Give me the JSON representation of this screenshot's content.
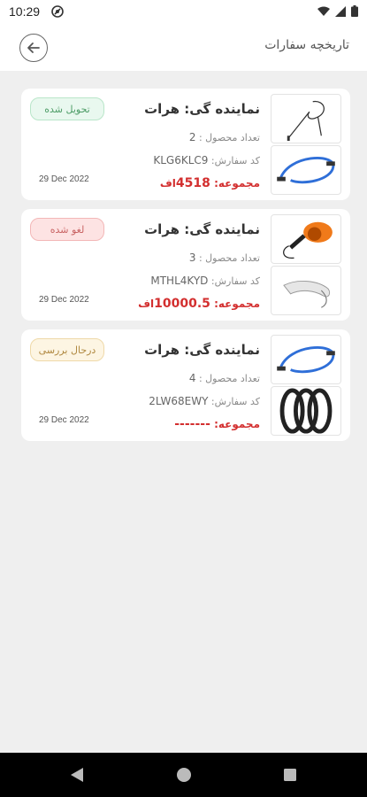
{
  "status_bar": {
    "time": "10:29"
  },
  "header": {
    "title": "تاریخچه سفارات"
  },
  "orders": [
    {
      "dealer": "نماینده گی: هرات",
      "count_label": "تعداد محصول :",
      "count": "2",
      "code_label": "کد سفارش:",
      "code": "KLG6KLC9",
      "total_label": "مجموعه:",
      "total": "4518",
      "currency": "اف",
      "status": "تحویل شده",
      "date": "29 Dec 2022"
    },
    {
      "dealer": "نماینده گی: هرات",
      "count_label": "تعداد محصول :",
      "count": "3",
      "code_label": "کد سفارش:",
      "code": "MTHL4KYD",
      "total_label": "مجموعه:",
      "total": "10000.5",
      "currency": "اف",
      "status": "لغو شده",
      "date": "29 Dec 2022"
    },
    {
      "dealer": "نماینده گی: هرات",
      "count_label": "تعداد محصول :",
      "count": "4",
      "code_label": "کد سفارش:",
      "code": "2LW68EWY",
      "total_label": "مجموعه:",
      "total": "-------",
      "currency": "",
      "status": "درحال بررسی",
      "date": "29 Dec 2022"
    }
  ],
  "colors": {
    "total_red": "#d32f2f",
    "delivered_green": "#4f9d68",
    "canceled_red": "#c96464",
    "review_amber": "#b08840"
  },
  "icons": {
    "back": "arrow-left-icon",
    "nav": [
      "nav-back-icon",
      "nav-home-icon",
      "nav-recents-icon"
    ]
  }
}
